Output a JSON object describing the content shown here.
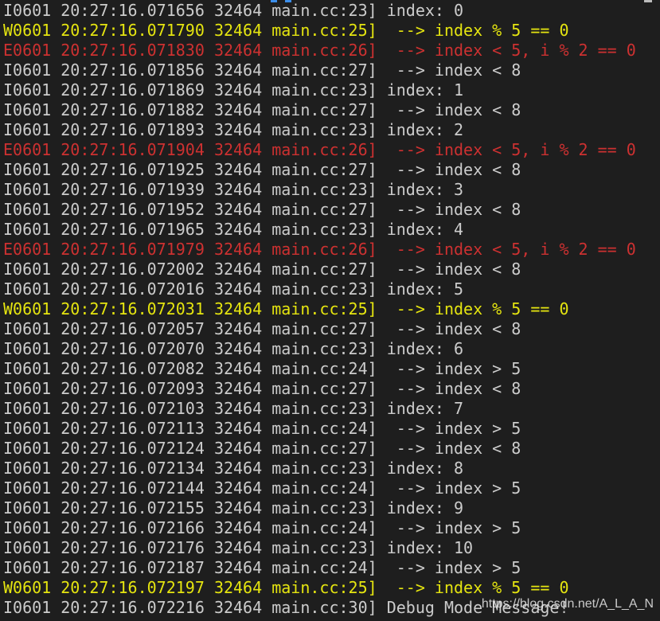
{
  "terminal": {
    "colors": {
      "background": "#1e1e1e",
      "info": "#cccccc",
      "warning": "#e5e510",
      "error": "#cd3131"
    },
    "lines": [
      {
        "level": "info",
        "prefix": "I0601",
        "time": "20:27:16.071656",
        "thread": "32464",
        "source": "main.cc:23]",
        "message": "index: 0"
      },
      {
        "level": "warn",
        "prefix": "W0601",
        "time": "20:27:16.071790",
        "thread": "32464",
        "source": "main.cc:25]",
        "message": " --> index % 5 == 0"
      },
      {
        "level": "error",
        "prefix": "E0601",
        "time": "20:27:16.071830",
        "thread": "32464",
        "source": "main.cc:26]",
        "message": " --> index < 5, i % 2 == 0"
      },
      {
        "level": "info",
        "prefix": "I0601",
        "time": "20:27:16.071856",
        "thread": "32464",
        "source": "main.cc:27]",
        "message": " --> index < 8"
      },
      {
        "level": "info",
        "prefix": "I0601",
        "time": "20:27:16.071869",
        "thread": "32464",
        "source": "main.cc:23]",
        "message": "index: 1"
      },
      {
        "level": "info",
        "prefix": "I0601",
        "time": "20:27:16.071882",
        "thread": "32464",
        "source": "main.cc:27]",
        "message": " --> index < 8"
      },
      {
        "level": "info",
        "prefix": "I0601",
        "time": "20:27:16.071893",
        "thread": "32464",
        "source": "main.cc:23]",
        "message": "index: 2"
      },
      {
        "level": "error",
        "prefix": "E0601",
        "time": "20:27:16.071904",
        "thread": "32464",
        "source": "main.cc:26]",
        "message": " --> index < 5, i % 2 == 0"
      },
      {
        "level": "info",
        "prefix": "I0601",
        "time": "20:27:16.071925",
        "thread": "32464",
        "source": "main.cc:27]",
        "message": " --> index < 8"
      },
      {
        "level": "info",
        "prefix": "I0601",
        "time": "20:27:16.071939",
        "thread": "32464",
        "source": "main.cc:23]",
        "message": "index: 3"
      },
      {
        "level": "info",
        "prefix": "I0601",
        "time": "20:27:16.071952",
        "thread": "32464",
        "source": "main.cc:27]",
        "message": " --> index < 8"
      },
      {
        "level": "info",
        "prefix": "I0601",
        "time": "20:27:16.071965",
        "thread": "32464",
        "source": "main.cc:23]",
        "message": "index: 4"
      },
      {
        "level": "error",
        "prefix": "E0601",
        "time": "20:27:16.071979",
        "thread": "32464",
        "source": "main.cc:26]",
        "message": " --> index < 5, i % 2 == 0"
      },
      {
        "level": "info",
        "prefix": "I0601",
        "time": "20:27:16.072002",
        "thread": "32464",
        "source": "main.cc:27]",
        "message": " --> index < 8"
      },
      {
        "level": "info",
        "prefix": "I0601",
        "time": "20:27:16.072016",
        "thread": "32464",
        "source": "main.cc:23]",
        "message": "index: 5"
      },
      {
        "level": "warn",
        "prefix": "W0601",
        "time": "20:27:16.072031",
        "thread": "32464",
        "source": "main.cc:25]",
        "message": " --> index % 5 == 0"
      },
      {
        "level": "info",
        "prefix": "I0601",
        "time": "20:27:16.072057",
        "thread": "32464",
        "source": "main.cc:27]",
        "message": " --> index < 8"
      },
      {
        "level": "info",
        "prefix": "I0601",
        "time": "20:27:16.072070",
        "thread": "32464",
        "source": "main.cc:23]",
        "message": "index: 6"
      },
      {
        "level": "info",
        "prefix": "I0601",
        "time": "20:27:16.072082",
        "thread": "32464",
        "source": "main.cc:24]",
        "message": " --> index > 5"
      },
      {
        "level": "info",
        "prefix": "I0601",
        "time": "20:27:16.072093",
        "thread": "32464",
        "source": "main.cc:27]",
        "message": " --> index < 8"
      },
      {
        "level": "info",
        "prefix": "I0601",
        "time": "20:27:16.072103",
        "thread": "32464",
        "source": "main.cc:23]",
        "message": "index: 7"
      },
      {
        "level": "info",
        "prefix": "I0601",
        "time": "20:27:16.072113",
        "thread": "32464",
        "source": "main.cc:24]",
        "message": " --> index > 5"
      },
      {
        "level": "info",
        "prefix": "I0601",
        "time": "20:27:16.072124",
        "thread": "32464",
        "source": "main.cc:27]",
        "message": " --> index < 8"
      },
      {
        "level": "info",
        "prefix": "I0601",
        "time": "20:27:16.072134",
        "thread": "32464",
        "source": "main.cc:23]",
        "message": "index: 8"
      },
      {
        "level": "info",
        "prefix": "I0601",
        "time": "20:27:16.072144",
        "thread": "32464",
        "source": "main.cc:24]",
        "message": " --> index > 5"
      },
      {
        "level": "info",
        "prefix": "I0601",
        "time": "20:27:16.072155",
        "thread": "32464",
        "source": "main.cc:23]",
        "message": "index: 9"
      },
      {
        "level": "info",
        "prefix": "I0601",
        "time": "20:27:16.072166",
        "thread": "32464",
        "source": "main.cc:24]",
        "message": " --> index > 5"
      },
      {
        "level": "info",
        "prefix": "I0601",
        "time": "20:27:16.072176",
        "thread": "32464",
        "source": "main.cc:23]",
        "message": "index: 10"
      },
      {
        "level": "info",
        "prefix": "I0601",
        "time": "20:27:16.072187",
        "thread": "32464",
        "source": "main.cc:24]",
        "message": " --> index > 5"
      },
      {
        "level": "warn",
        "prefix": "W0601",
        "time": "20:27:16.072197",
        "thread": "32464",
        "source": "main.cc:25]",
        "message": " --> index % 5 == 0"
      },
      {
        "level": "info",
        "prefix": "I0601",
        "time": "20:27:16.072216",
        "thread": "32464",
        "source": "main.cc:30]",
        "message": "Debug Mode Message!"
      }
    ]
  },
  "watermark": "https://blog.csdn.net/A_L_A_N"
}
